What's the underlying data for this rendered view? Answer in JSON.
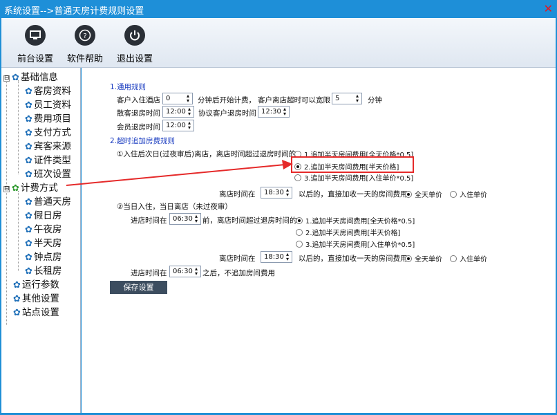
{
  "window": {
    "title": "系统设置-->普通天房计费规则设置",
    "close_glyph": "✕"
  },
  "toolbar": {
    "buttons": [
      {
        "label": "前台设置",
        "icon": "monitor-icon"
      },
      {
        "label": "软件帮助",
        "icon": "help-icon"
      },
      {
        "label": "退出设置",
        "icon": "power-icon"
      }
    ]
  },
  "tree": {
    "basic_info": "基础信息",
    "basic_children": [
      "客房资料",
      "员工资料",
      "费用项目",
      "支付方式",
      "宾客来源",
      "证件类型",
      "班次设置"
    ],
    "billing": "计费方式",
    "billing_children": [
      "普通天房",
      "假日房",
      "午夜房",
      "半天房",
      "钟点房",
      "长租房"
    ],
    "others": [
      "运行参数",
      "其他设置",
      "站点设置"
    ],
    "expander": "⊟"
  },
  "form": {
    "section1_title": "1.通用规则",
    "checkin_label": "客户入住酒店",
    "checkin_minutes": "0",
    "checkin_suffix": "分钟后开始计费，",
    "overtime_label": "客户离店超时可以宽限",
    "overtime_minutes": "5",
    "overtime_suffix": "分钟",
    "scatter_checkout_label": "散客退房时间",
    "scatter_checkout_time": "12:00",
    "agreement_checkout_label": "协议客户退房时间",
    "agreement_checkout_time": "12:30",
    "member_checkout_label": "会员退房时间",
    "member_checkout_time": "12:00",
    "section2_title": "2.超时追加房费规则",
    "case1_label": "①入住后次日(过夜审后)离店，离店时间超过退房时间的",
    "case1_options": [
      "1.追加半天房间费用[全天价格*0.5]",
      "2.追加半天房间费用[半天价格]",
      "3.追加半天房间费用[入住单价*0.5]"
    ],
    "case1_selected": 1,
    "leave_time_label": "离店时间在",
    "leave_time_value_1": "18:30",
    "leave_time_suffix": "以后的，直接加收一天的房间费用",
    "price_options": [
      "全天单价",
      "入住单价"
    ],
    "case2_label": "②当日入住，当日离店（未过夜审）",
    "checkin_time_label": "进店时间在",
    "checkin_time_value": "06:30",
    "checkin_time_suffix": "前，离店时间超过退房时间的",
    "case2_options": [
      "1.追加半天房间费用[全天价格*0.5]",
      "2.追加半天房间费用[半天价格]",
      "3.追加半天房间费用[入住单价*0.5]"
    ],
    "case2_selected": 0,
    "leave_time_value_2": "18:30",
    "checkin_time_value_2": "06:30",
    "checkin_after_suffix": "之后，不追加房间费用",
    "save_label": "保存设置"
  },
  "colors": {
    "titlebar": "#1e8fd8",
    "highlight": "#e52a2a",
    "link_blue": "#1a3cc0",
    "save_button": "#3c4d5f"
  }
}
